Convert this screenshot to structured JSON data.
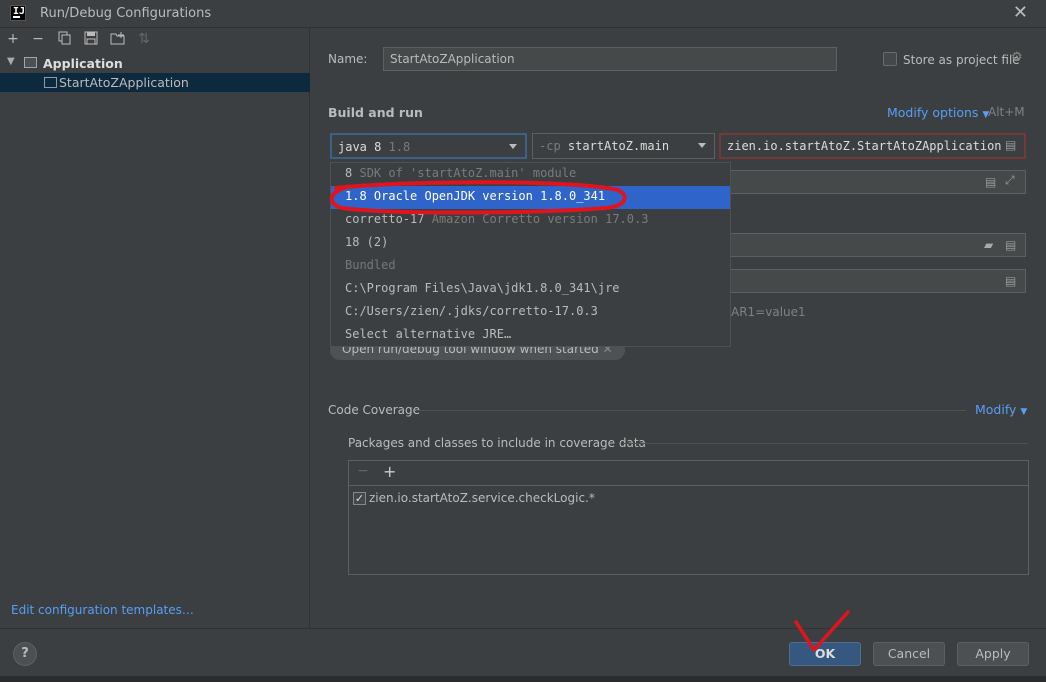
{
  "window": {
    "title": "Run/Debug Configurations",
    "logo_text": "IJ"
  },
  "left": {
    "tree_group": "Application",
    "tree_item": "StartAtoZApplication",
    "edit_templates": "Edit configuration templates…"
  },
  "form": {
    "name_label": "Name:",
    "name_value": "StartAtoZApplication",
    "store_label": "Store as project file",
    "build_run": "Build and run",
    "modify_options": "Modify options",
    "modify_shortcut": "Alt+M",
    "jre_name": "java 8",
    "jre_version": "1.8",
    "cp_prefix": "-cp",
    "cp_value": "startAtoZ.main",
    "main_class": "zien.io.startAtoZ.StartAtoZApplication",
    "env_hint": "AR1=value1",
    "chip_label": "Open run/debug tool window when started",
    "code_coverage": "Code Coverage",
    "modify": "Modify",
    "packages_label": "Packages and classes to include in coverage data",
    "coverage_pattern": "zien.io.startAtoZ.service.checkLogic.*"
  },
  "dropdown": {
    "item0_name": "8",
    "item0_desc": "SDK of 'startAtoZ.main' module",
    "item1": "1.8 Oracle OpenJDK version 1.8.0_341",
    "item2_name": "corretto-17",
    "item2_desc": "Amazon Corretto version 17.0.3",
    "item3": "18 (2)",
    "item4": "Bundled",
    "item5": "C:\\Program Files\\Java\\jdk1.8.0_341\\jre",
    "item6": "C:/Users/zien/.jdks/corretto-17.0.3",
    "item7": "Select alternative JRE…"
  },
  "buttons": {
    "help": "?",
    "ok": "OK",
    "cancel": "Cancel",
    "apply": "Apply"
  },
  "colors": {
    "accent": "#589df6",
    "selection": "#2f65ca",
    "annotation": "#e0141e"
  }
}
